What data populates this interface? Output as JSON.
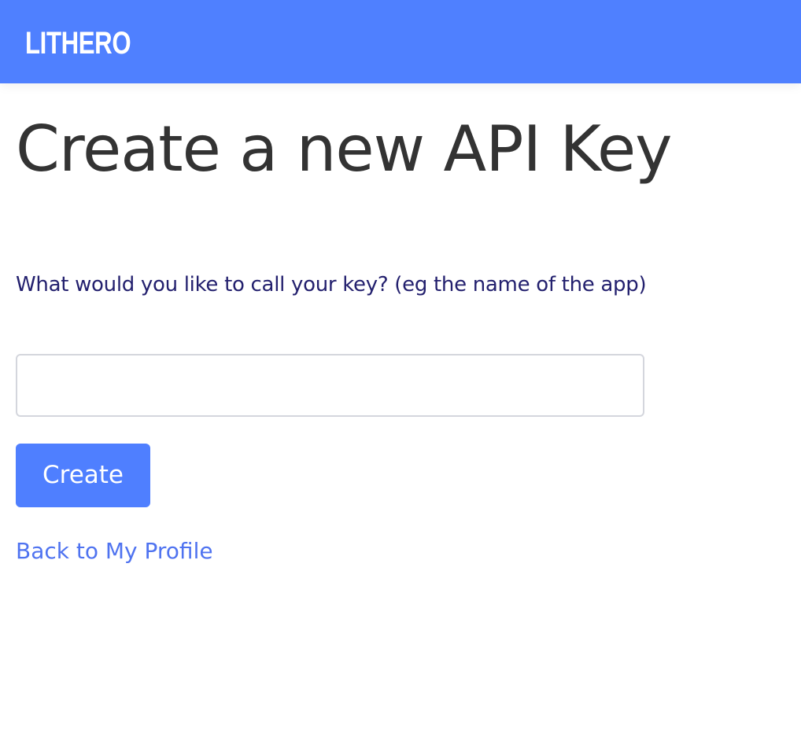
{
  "navbar": {
    "brand": "LITHERO",
    "background_color": "#4f80ff"
  },
  "main": {
    "title": "Create a new API Key",
    "form": {
      "name_label": "What would you like to call your key? (eg the name of the app)",
      "name_value": "",
      "name_placeholder": "",
      "submit_label": "Create"
    },
    "back_link": "Back to My Profile"
  },
  "colors": {
    "accent": "#4f7fff",
    "label_text": "#23206e",
    "title_text": "#333333",
    "link": "#4f73f0"
  }
}
